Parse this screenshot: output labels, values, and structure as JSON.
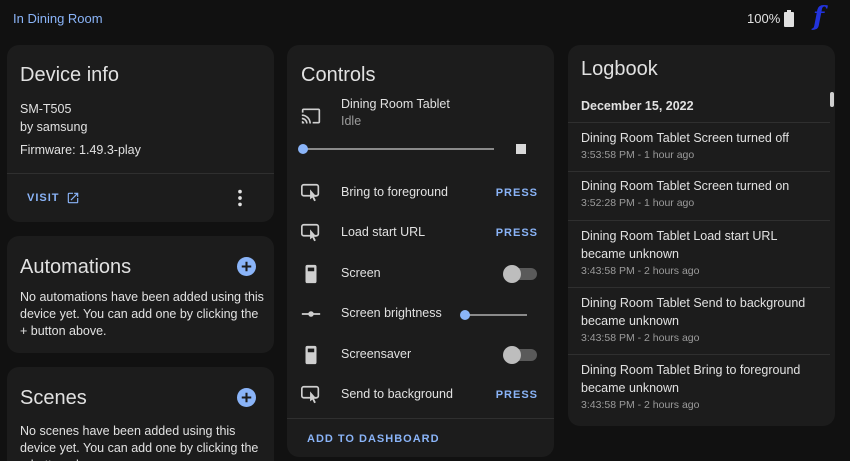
{
  "topbar": {
    "breadcrumb": "In Dining Room",
    "battery_level": "100%",
    "logo_letter": "f"
  },
  "device_info": {
    "title": "Device info",
    "model": "SM-T505",
    "manufacturer": "by samsung",
    "firmware": "Firmware: 1.49.3-play",
    "visit_label": "VISIT"
  },
  "automations": {
    "title": "Automations",
    "empty_text": "No automations have been added using this device yet. You can add one by clicking the + button above."
  },
  "scenes": {
    "title": "Scenes",
    "empty_text": "No scenes have been added using this device yet. You can add one by clicking the + button above."
  },
  "controls": {
    "title": "Controls",
    "media": {
      "name": "Dining Room Tablet",
      "state": "Idle",
      "volume_level": 0
    },
    "rows": [
      {
        "label": "Bring to foreground",
        "action": "PRESS"
      },
      {
        "label": "Load start URL",
        "action": "PRESS"
      },
      {
        "label": "Screen",
        "toggle_on": false
      },
      {
        "label": "Screen brightness",
        "slider_level": 0
      },
      {
        "label": "Screensaver",
        "toggle_on": false
      },
      {
        "label": "Send to background",
        "action": "PRESS"
      }
    ],
    "add_to_dashboard": "ADD TO DASHBOARD"
  },
  "logbook": {
    "title": "Logbook",
    "date": "December 15, 2022",
    "entries": [
      {
        "title": "Dining Room Tablet Screen turned off",
        "time": "3:53:58 PM - 1 hour ago"
      },
      {
        "title": "Dining Room Tablet Screen turned on",
        "time": "3:52:28 PM - 1 hour ago"
      },
      {
        "title": "Dining Room Tablet Load start URL became unknown",
        "time": "3:43:58 PM - 2 hours ago"
      },
      {
        "title": "Dining Room Tablet Send to background became unknown",
        "time": "3:43:58 PM - 2 hours ago"
      },
      {
        "title": "Dining Room Tablet Bring to foreground became unknown",
        "time": "3:43:58 PM - 2 hours ago"
      }
    ]
  },
  "colors": {
    "accent": "#8ab4f8",
    "card_bg": "#1c1c1c",
    "page_bg": "#111111"
  }
}
